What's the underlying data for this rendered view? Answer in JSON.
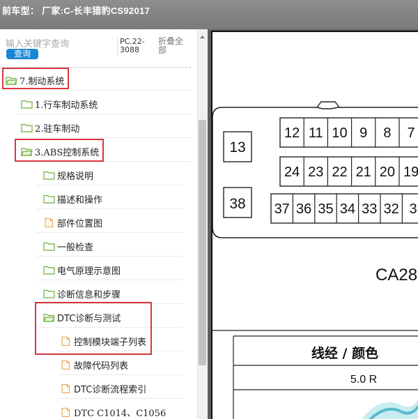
{
  "header": {
    "title": "前车型： 厂家:C-长丰猎豹CS92017"
  },
  "search": {
    "placeholder": "输入关键字查询",
    "button_label": "查询"
  },
  "version": "PC.22-\n3088",
  "collapse_label": "折叠全\n部",
  "tree": {
    "nodes": [
      {
        "label": "7.制动系统",
        "icon": "folder-open-icon"
      },
      {
        "label": "1.行车制动系统",
        "icon": "folder-icon"
      },
      {
        "label": "2.驻车制动",
        "icon": "folder-icon"
      },
      {
        "label": "3.ABS控制系统",
        "icon": "folder-open-icon"
      },
      {
        "label": "规格说明",
        "icon": "folder-icon"
      },
      {
        "label": "描述和操作",
        "icon": "folder-icon"
      },
      {
        "label": "部件位置图",
        "icon": "document-icon"
      },
      {
        "label": "一般检查",
        "icon": "folder-icon"
      },
      {
        "label": "电气原理示意图",
        "icon": "folder-icon"
      },
      {
        "label": "诊断信息和步骤",
        "icon": "folder-icon"
      },
      {
        "label": "DTC诊断与测试",
        "icon": "folder-open-icon"
      },
      {
        "label": "控制模块端子列表",
        "icon": "document-icon"
      },
      {
        "label": "故障代码列表",
        "icon": "document-icon"
      },
      {
        "label": "DTC诊断流程索引",
        "icon": "document-icon"
      },
      {
        "label": "DTC C1014、C1056",
        "icon": "document-icon"
      }
    ]
  },
  "document": {
    "pins_row1": [
      "12",
      "11",
      "10",
      "9",
      "8",
      "7"
    ],
    "pins_row2": [
      "24",
      "23",
      "22",
      "21",
      "20",
      "19"
    ],
    "pins_row3": [
      "37",
      "36",
      "35",
      "34",
      "33",
      "32",
      "3"
    ],
    "side_pin_top": "13",
    "side_pin_bottom": "38",
    "connector_code": "CA28",
    "table_header": "线经 / 颜色",
    "table_first_value": "5.0 R"
  },
  "colors": {
    "accent": "#1a86d6",
    "highlight": "#d9363e",
    "folder": "#6cae3a",
    "document": "#e9a34a"
  }
}
